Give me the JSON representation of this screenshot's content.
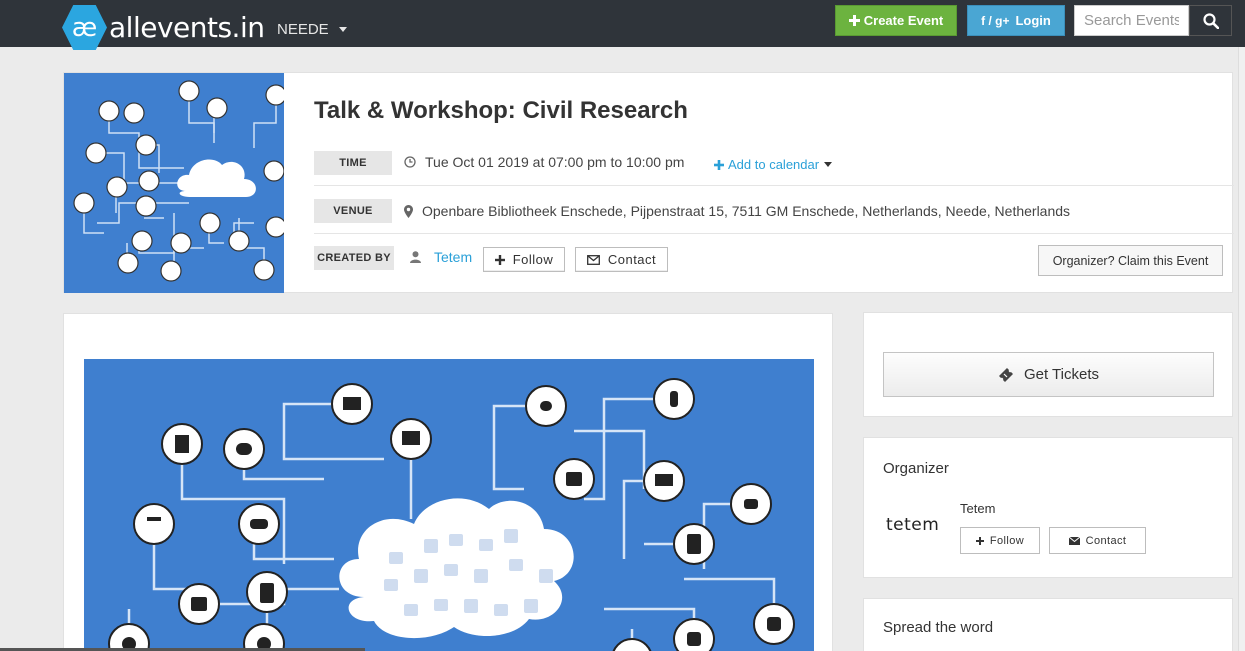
{
  "nav": {
    "brand": "allevents.in",
    "logo_glyph": "æ",
    "city": "NEEDE",
    "create_event": "Create Event",
    "login": "Login",
    "login_prefix": "f / g+",
    "search_placeholder": "Search Events"
  },
  "event": {
    "title": "Talk & Workshop: Civil Research",
    "time_label": "TIME",
    "time_value": "Tue Oct 01 2019 at 07:00 pm to 10:00 pm",
    "add_to_calendar": "Add to calendar",
    "venue_label": "VENUE",
    "venue_value": "Openbare Bibliotheek Enschede, Pijpenstraat 15, 7511 GM Enschede, Netherlands, Neede, Netherlands",
    "created_by_label": "CREATED BY",
    "creator": "Tetem",
    "follow": "Follow",
    "contact": "Contact",
    "claim": "Organizer? Claim this Event"
  },
  "sidebar": {
    "get_tickets": "Get Tickets",
    "organizer_heading": "Organizer",
    "organizer_logo_text": "tetem",
    "organizer_name": "Tetem",
    "follow": "Follow",
    "contact": "Contact",
    "spread_heading": "Spread the word"
  },
  "colors": {
    "topbar": "#2f343a",
    "create_green": "#6cb33f",
    "login_blue": "#4aa6d3",
    "image_blue": "#3f7fcf",
    "link_blue": "#2aa0d8"
  }
}
